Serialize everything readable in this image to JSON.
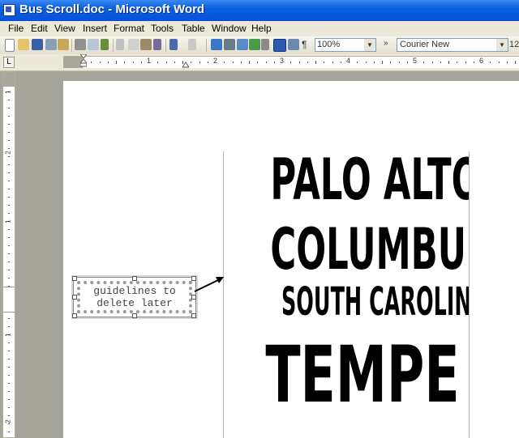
{
  "window": {
    "title": "Bus Scroll.doc - Microsoft Word"
  },
  "menu": [
    "File",
    "Edit",
    "View",
    "Insert",
    "Format",
    "Tools",
    "Table",
    "Window",
    "Help"
  ],
  "toolbar": {
    "zoom_value": "100%",
    "font_name": "Courier New",
    "font_size": "12",
    "icons": [
      "new-icon",
      "open-icon",
      "save-icon",
      "permission-icon",
      "email-icon",
      "print-icon",
      "print-preview-icon",
      "spelling-icon",
      "cut-icon",
      "copy-icon",
      "paste-icon",
      "format-painter-icon",
      "undo-icon",
      "redo-icon",
      "hyperlink-icon",
      "tables-borders-icon",
      "insert-table-icon",
      "insert-excel-icon",
      "columns-icon",
      "drawing-icon",
      "document-map-icon",
      "show-hide-icon"
    ]
  },
  "rulers": {
    "horizontal_numbers": [
      "1",
      "2",
      "3",
      "4",
      "5",
      "6"
    ],
    "vertical_numbers": [
      "1",
      "2",
      "1",
      "1",
      "2"
    ]
  },
  "document": {
    "picture_lines": [
      "PALO ALTO",
      "COLUMBUS",
      "SOUTH CAROLINA",
      "TEMPE"
    ],
    "textbox_line1": "guidelines to",
    "textbox_line2": "delete later"
  },
  "colors": {
    "titlebar": "#0a5fe0",
    "chrome": "#ece9d8",
    "workspace": "#a6a59b",
    "page": "#ffffff"
  }
}
